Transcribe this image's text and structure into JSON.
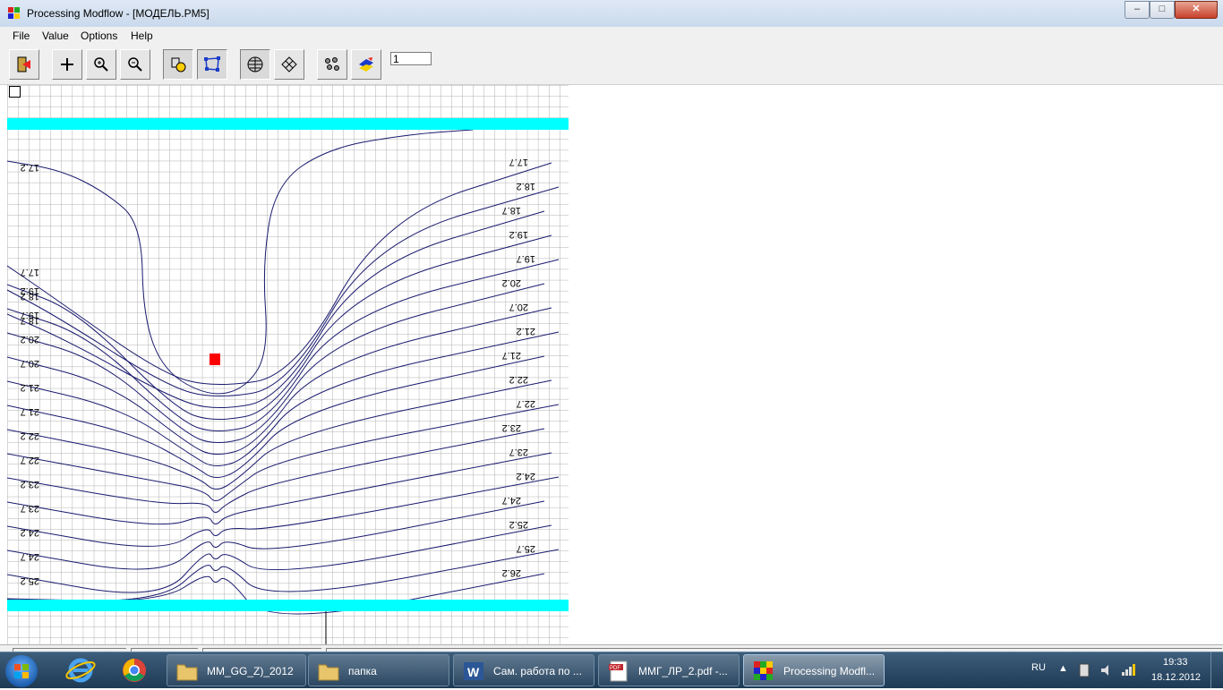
{
  "window": {
    "title": "Processing Modflow - [МОДЕЛЬ.PM5]",
    "minimize": "–",
    "maximize": "□",
    "close": "✕"
  },
  "menu": [
    "File",
    "Value",
    "Options",
    "Help"
  ],
  "toolbar": {
    "layer_value": "1",
    "buttons": [
      "exit-icon",
      "cross-cursor-icon",
      "zoom-in-icon",
      "zoom-out-icon",
      "cell-value-icon",
      "polygon-icon",
      "grid-view-icon",
      "grid-diamond-icon",
      "dots-icon",
      "map-layer-icon"
    ]
  },
  "colors": {
    "boundary": "#00ffff",
    "well": "#ff0000",
    "contour": "#1a1a6e",
    "grid": "#b0b0b0"
  },
  "contours": {
    "labels": [
      "17.2",
      "17.7",
      "18.2",
      "18.7",
      "19.2",
      "19.7",
      "20.2",
      "20.7",
      "21.2",
      "21.7",
      "22.2",
      "22.7",
      "23.2",
      "23.7",
      "24.2",
      "24.7",
      "25.2",
      "25.7",
      "26.2"
    ]
  },
  "taskbar": {
    "items": [
      {
        "label": "MM_GG_Z)_2012",
        "icon": "folder-icon"
      },
      {
        "label": "папка",
        "icon": "folder-icon"
      },
      {
        "label": "Сам. работа по ...",
        "icon": "word-icon"
      },
      {
        "label": "ММГ_ЛР_2.pdf -...",
        "icon": "pdf-icon"
      },
      {
        "label": "Processing Modfl...",
        "icon": "modflow-icon"
      }
    ],
    "lang": "RU",
    "time": "19:33",
    "date": "18.12.2012"
  }
}
